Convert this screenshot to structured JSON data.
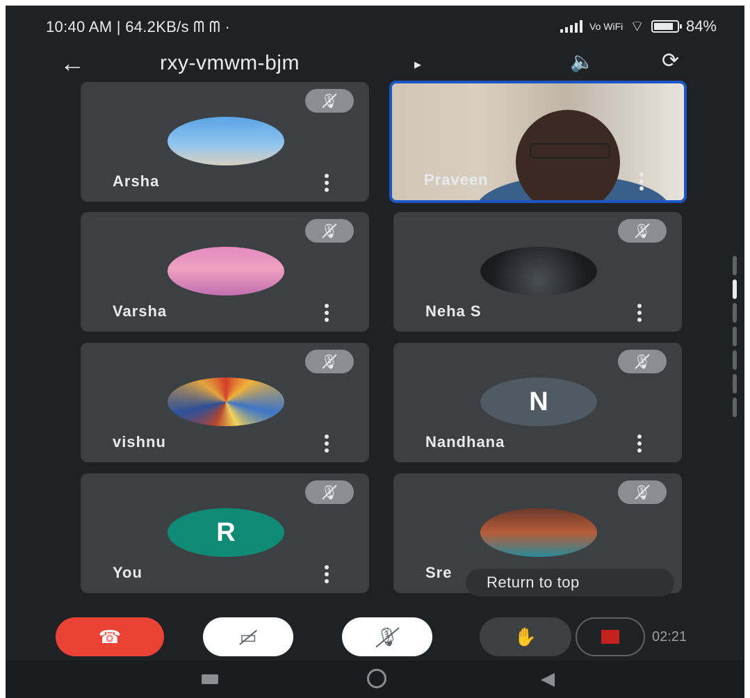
{
  "status_bar": {
    "time": "10:40 AM | 64.2KB/s",
    "notif": "ᗰ ᗰ ·",
    "volte": "Vo WiFi",
    "battery": "84%",
    "battery_level": 0.84
  },
  "header": {
    "meeting_code": "rxy-vmwm-bjm",
    "caret": "▸"
  },
  "participants": [
    {
      "name": "Arsha"
    },
    {
      "name": "Praveen"
    },
    {
      "name": "Varsha"
    },
    {
      "name": "Neha S"
    },
    {
      "name": "vishnu"
    },
    {
      "name": "Nandhana",
      "initial": "N"
    },
    {
      "name": "You",
      "initial": "R"
    },
    {
      "name": "Sre"
    }
  ],
  "return_to_top": "Return to top",
  "controls": {
    "timer": "02:21"
  },
  "colors": {
    "background": "#202124",
    "tile": "#3c4043",
    "active_border": "#1a56c4",
    "hangup": "#ea4335",
    "record": "#c5221f"
  },
  "icons": [
    "back-arrow-icon",
    "speaker-icon",
    "camera-flip-icon",
    "mic-off-icon",
    "more-vert-icon",
    "hangup-icon",
    "camera-off-icon",
    "raise-hand-icon",
    "record-icon"
  ]
}
